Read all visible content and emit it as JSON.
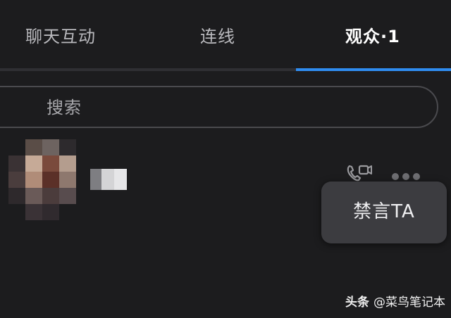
{
  "tabs": [
    {
      "label": "聊天互动",
      "active": false
    },
    {
      "label": "连线",
      "active": false
    },
    {
      "label": "观众·1",
      "active": true
    }
  ],
  "colors": {
    "background": "#1c1c1e",
    "accent": "#2f8cf0",
    "popup": "#3c3c40"
  },
  "search": {
    "placeholder": "搜索"
  },
  "audience_list": [
    {
      "avatar": "pixelated-avatar",
      "name": "pixelated-name",
      "actions": [
        "video-call-icon",
        "more-icon"
      ]
    }
  ],
  "popup_menu": {
    "items": [
      {
        "label": "禁言TA"
      }
    ]
  },
  "watermark": {
    "brand": "头条",
    "author": "@菜鸟笔记本"
  }
}
